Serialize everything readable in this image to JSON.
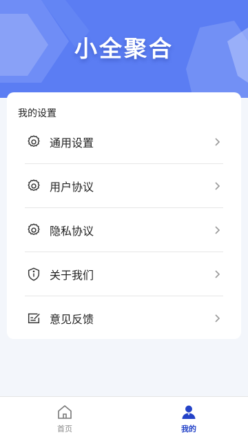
{
  "header": {
    "title": "小全聚合",
    "bg_color": "#5b7df3"
  },
  "settings": {
    "section_title": "我的设置",
    "items": [
      {
        "label": "通用设置",
        "icon": "gear-icon"
      },
      {
        "label": "用户协议",
        "icon": "gear-icon"
      },
      {
        "label": "隐私协议",
        "icon": "gear-icon"
      },
      {
        "label": "关于我们",
        "icon": "info-shield-icon"
      },
      {
        "label": "意见反馈",
        "icon": "feedback-icon"
      }
    ]
  },
  "tabbar": {
    "tabs": [
      {
        "label": "首页",
        "icon": "home-icon",
        "active": false
      },
      {
        "label": "我的",
        "icon": "user-icon",
        "active": true
      }
    ],
    "active_color": "#2443c8"
  }
}
